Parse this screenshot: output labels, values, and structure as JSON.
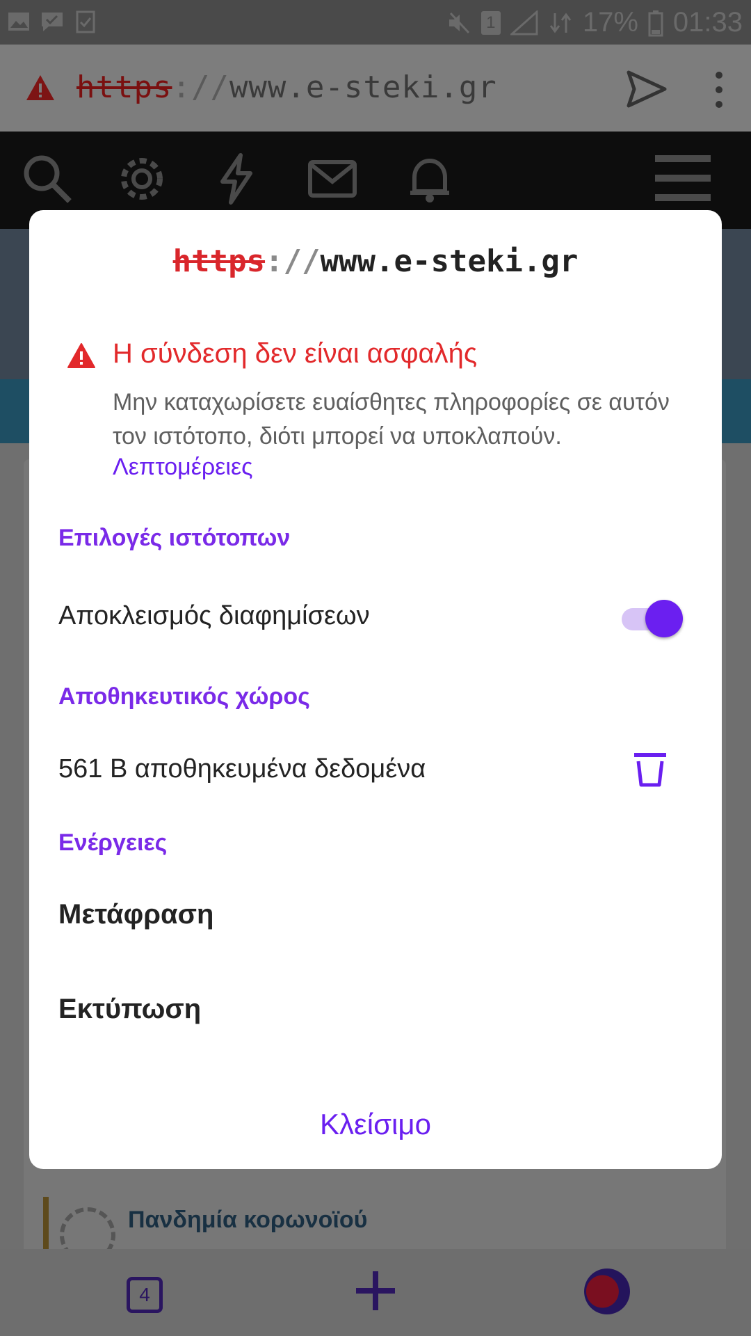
{
  "status_bar": {
    "battery": "17%",
    "time": "01:33",
    "sim_slot": "1"
  },
  "browser": {
    "url_protocol": "https",
    "url_separator": "://",
    "url_host": "www.e-steki.gr",
    "tab_count": "4"
  },
  "background_page": {
    "forum_item_title": "Πανδημία κορωνοϊού"
  },
  "dialog": {
    "url_protocol": "https",
    "url_separator": "://",
    "url_host": "www.e-steki.gr",
    "warning_title": "Η σύνδεση δεν είναι ασφαλής",
    "warning_text": "Μην καταχωρίσετε ευαίσθητες πληροφορίες σε αυτόν τον ιστότοπο, διότι μπορεί να υποκλαπούν.",
    "details_link": "Λεπτομέρειες",
    "site_options_heading": "Επιλογές ιστότοπων",
    "ad_block_label": "Αποκλεισμός διαφημίσεων",
    "ad_block_enabled": true,
    "storage_heading": "Αποθηκευτικός χώρος",
    "storage_label": "561 B αποθηκευμένα δεδομένα",
    "actions_heading": "Ενέργειες",
    "translate_label": "Μετάφραση",
    "print_label": "Εκτύπωση",
    "close_label": "Κλείσιμο"
  },
  "colors": {
    "accent": "#6a1ff0",
    "section_heading": "#7a2ae8",
    "warning": "#e2292b",
    "dim_overlay": "#7a7a7a"
  }
}
